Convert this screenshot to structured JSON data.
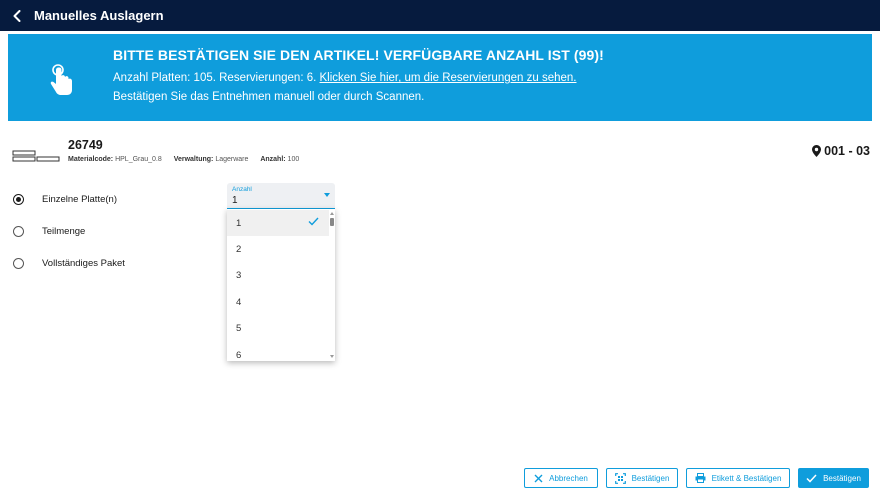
{
  "header": {
    "title": "Manuelles Auslagern",
    "back_icon": "chevron-left-icon"
  },
  "banner": {
    "title": "BITTE BESTÄTIGEN SIE DEN ARTIKEL! VERFÜGBARE ANZAHL IST (99)!",
    "line1_prefix": "Anzahl Platten: 105. Reservierungen: 6.",
    "line1_link": "Klicken Sie hier, um die Reservierungen zu sehen.",
    "line2": "Bestätigen Sie das Entnehmen manuell oder durch Scannen.",
    "icon": "touch-hand-icon",
    "color": "#0f9ddc"
  },
  "article": {
    "number": "26749",
    "material_label": "Materialcode:",
    "material_value": "HPL_Grau_0.8",
    "management_label": "Verwaltung:",
    "management_value": "Lagerware",
    "quantity_label": "Anzahl:",
    "quantity_value": "100",
    "location": "001 - 03"
  },
  "options": [
    {
      "label": "Einzelne Platte(n)",
      "selected": true
    },
    {
      "label": "Teilmenge",
      "selected": false
    },
    {
      "label": "Vollständiges Paket",
      "selected": false
    }
  ],
  "quantity_select": {
    "label": "Anzahl",
    "value": "1",
    "options": [
      "1",
      "2",
      "3",
      "4",
      "5",
      "6"
    ]
  },
  "footer": {
    "cancel": "Abbrechen",
    "confirm_scan": "Bestätigen",
    "label_confirm": "Etikett & Bestätigen",
    "confirm": "Bestätigen"
  },
  "colors": {
    "navy": "#061b3e",
    "accent": "#0f9ddc"
  }
}
